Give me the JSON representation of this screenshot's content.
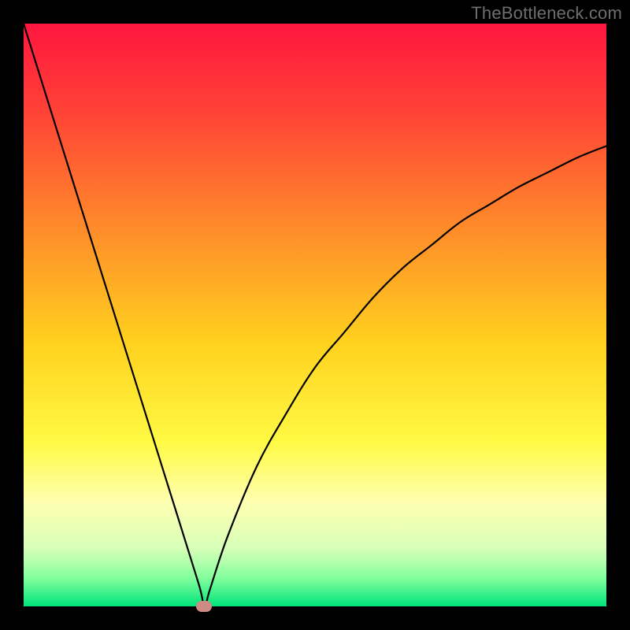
{
  "watermark": "TheBottleneck.com",
  "chart_data": {
    "type": "line",
    "title": "",
    "xlabel": "",
    "ylabel": "",
    "xlim": [
      0,
      100
    ],
    "ylim": [
      0,
      100
    ],
    "grid": false,
    "legend": false,
    "series": [
      {
        "name": "bottleneck-curve",
        "x": [
          0,
          5,
          10,
          15,
          20,
          25,
          30,
          31,
          32,
          35,
          40,
          45,
          50,
          55,
          60,
          65,
          70,
          75,
          80,
          85,
          90,
          95,
          100
        ],
        "y": [
          100,
          84,
          68,
          52,
          36,
          20,
          4,
          0,
          3,
          12,
          24,
          33,
          41,
          47,
          53,
          58,
          62,
          66,
          69,
          72,
          74.5,
          77,
          79
        ]
      }
    ],
    "marker": {
      "x": 31,
      "y": 0
    },
    "background_gradient": {
      "stops": [
        {
          "offset": 0.0,
          "color": "#ff163f"
        },
        {
          "offset": 0.15,
          "color": "#ff4236"
        },
        {
          "offset": 0.35,
          "color": "#ff8b2a"
        },
        {
          "offset": 0.55,
          "color": "#ffd21e"
        },
        {
          "offset": 0.72,
          "color": "#fffa45"
        },
        {
          "offset": 0.82,
          "color": "#ffffb0"
        },
        {
          "offset": 0.9,
          "color": "#d8ffb8"
        },
        {
          "offset": 0.95,
          "color": "#86ff9e"
        },
        {
          "offset": 1.0,
          "color": "#00e47a"
        }
      ]
    }
  }
}
